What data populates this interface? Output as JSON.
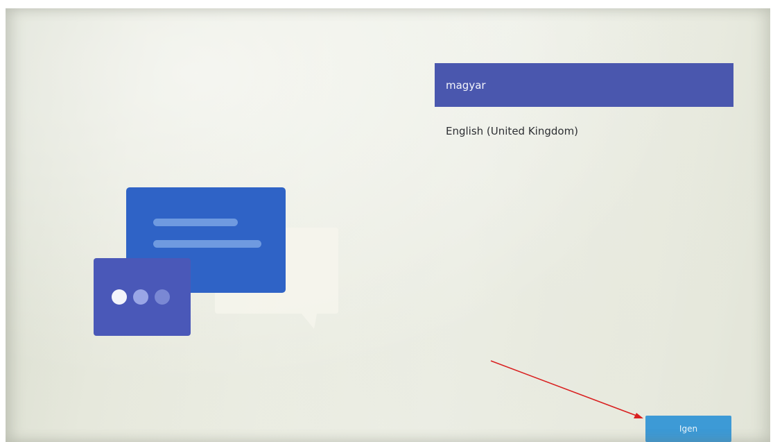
{
  "languages": [
    {
      "label": "magyar",
      "selected": true
    },
    {
      "label": "English (United Kingdom)",
      "selected": false
    }
  ],
  "footer": {
    "primary_button_label": "Igen"
  },
  "colors": {
    "selection": "#4a57ae",
    "accent_button": "#3d9ad6",
    "annotation_arrow": "#d92020"
  },
  "illustration": {
    "icon": "chat-bubbles-language-illustration"
  }
}
